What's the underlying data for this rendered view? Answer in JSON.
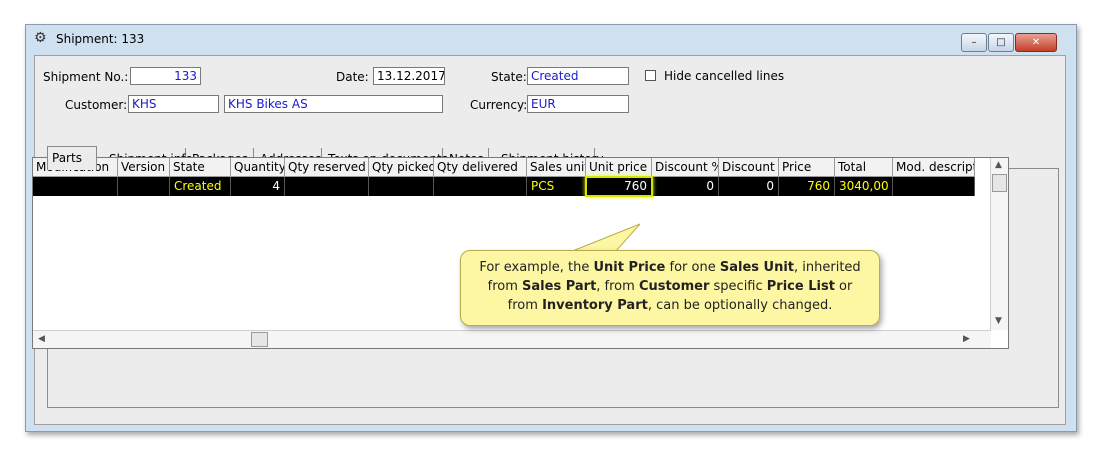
{
  "window": {
    "title": "Shipment: 133",
    "controls": {
      "minimize": "–",
      "maximize": "□",
      "close": "✕"
    }
  },
  "form": {
    "shipment_no_label": "Shipment No.:",
    "shipment_no": "133",
    "date_label": "Date:",
    "date": "13.12.2017",
    "state_label": "State:",
    "state": "Created",
    "hide_cancelled_label": "Hide cancelled lines",
    "customer_label": "Customer:",
    "customer_code": "KHS",
    "customer_name": "KHS Bikes AS",
    "currency_label": "Currency:",
    "currency": "EUR"
  },
  "tabs": [
    "Parts",
    "Shipment info",
    "Packages",
    "Addresses",
    "Texts on documents",
    "Notes",
    "Shipment history"
  ],
  "grid": {
    "columns": [
      "Modification",
      "Version",
      "State",
      "Quantity",
      "Qty reserved",
      "Qty picked",
      "Qty delivered",
      "Sales unit",
      "Unit price",
      "Discount %",
      "Discount",
      "Price",
      "Total",
      "Mod. descriptio"
    ],
    "rows": [
      [
        "",
        "",
        "Created",
        "4",
        "",
        "",
        "",
        "PCS",
        "760",
        "0",
        "0",
        "760",
        "3040,00",
        ""
      ]
    ]
  },
  "callout": {
    "segments": [
      {
        "t": "For example, the ",
        "b": false
      },
      {
        "t": "Unit Price",
        "b": true
      },
      {
        "t": " for one ",
        "b": false
      },
      {
        "t": "Sales Unit",
        "b": true
      },
      {
        "t": ", inherited from ",
        "b": false
      },
      {
        "t": "Sales Part",
        "b": true
      },
      {
        "t": ", from ",
        "b": false
      },
      {
        "t": "Customer",
        "b": true
      },
      {
        "t": " specific ",
        "b": false
      },
      {
        "t": "Price List",
        "b": true
      },
      {
        "t": " or from ",
        "b": false
      },
      {
        "t": "Inventory Part",
        "b": true
      },
      {
        "t": ", can be optionally changed.",
        "b": false
      }
    ]
  },
  "colors": {
    "row_bg": "#000000",
    "row_text": "#ffff00",
    "callout_bg": "#fdf6a3",
    "highlight": "#d5e400"
  }
}
